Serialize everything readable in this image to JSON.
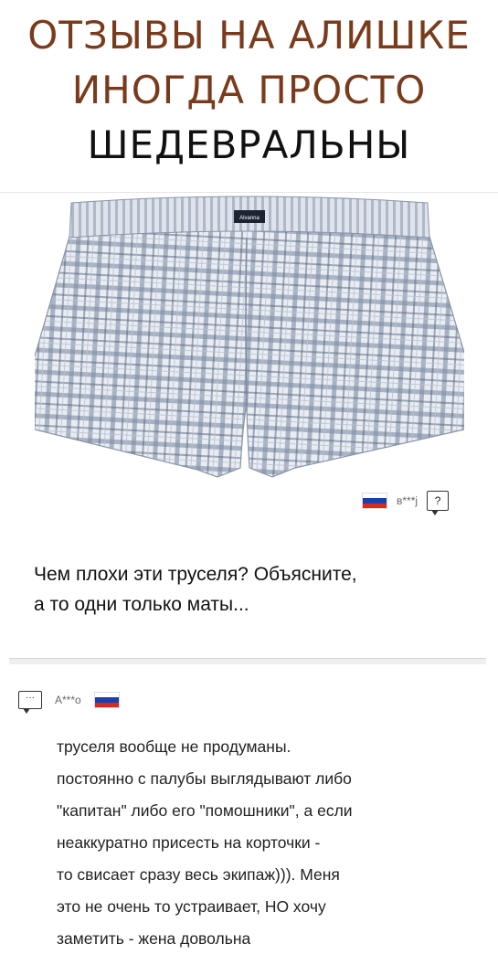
{
  "header": {
    "line1": "ОТЗЫВЫ НА АЛИШКЕ",
    "line2": "ИНОГДА ПРОСТО",
    "line3": "ШЕДЕВРАЛЬНЫ"
  },
  "product": {
    "label_text": "Alvanna"
  },
  "review": {
    "username": "в***ј",
    "question_icon": "?",
    "text_lines": [
      "Чем плохи эти труселя? Объясните,",
      "а то одни только маты..."
    ]
  },
  "reply": {
    "icon": "···",
    "username": "А***о",
    "text_lines": [
      "труселя вообще не продуманы.",
      "постоянно с палубы выглядывают либо",
      "\"капитан\" либо его \"помошники\", а если",
      "неаккуратно присесть на корточки -",
      "то свисает сразу весь экипаж))). Меня",
      "это не очень то устраивает, НО хочу",
      "заметить - жена довольна"
    ]
  },
  "colors": {
    "title_brown": "#7a3b1c",
    "flag_white": "#ffffff",
    "flag_blue": "#1c3fae",
    "flag_red": "#d52b1e"
  }
}
